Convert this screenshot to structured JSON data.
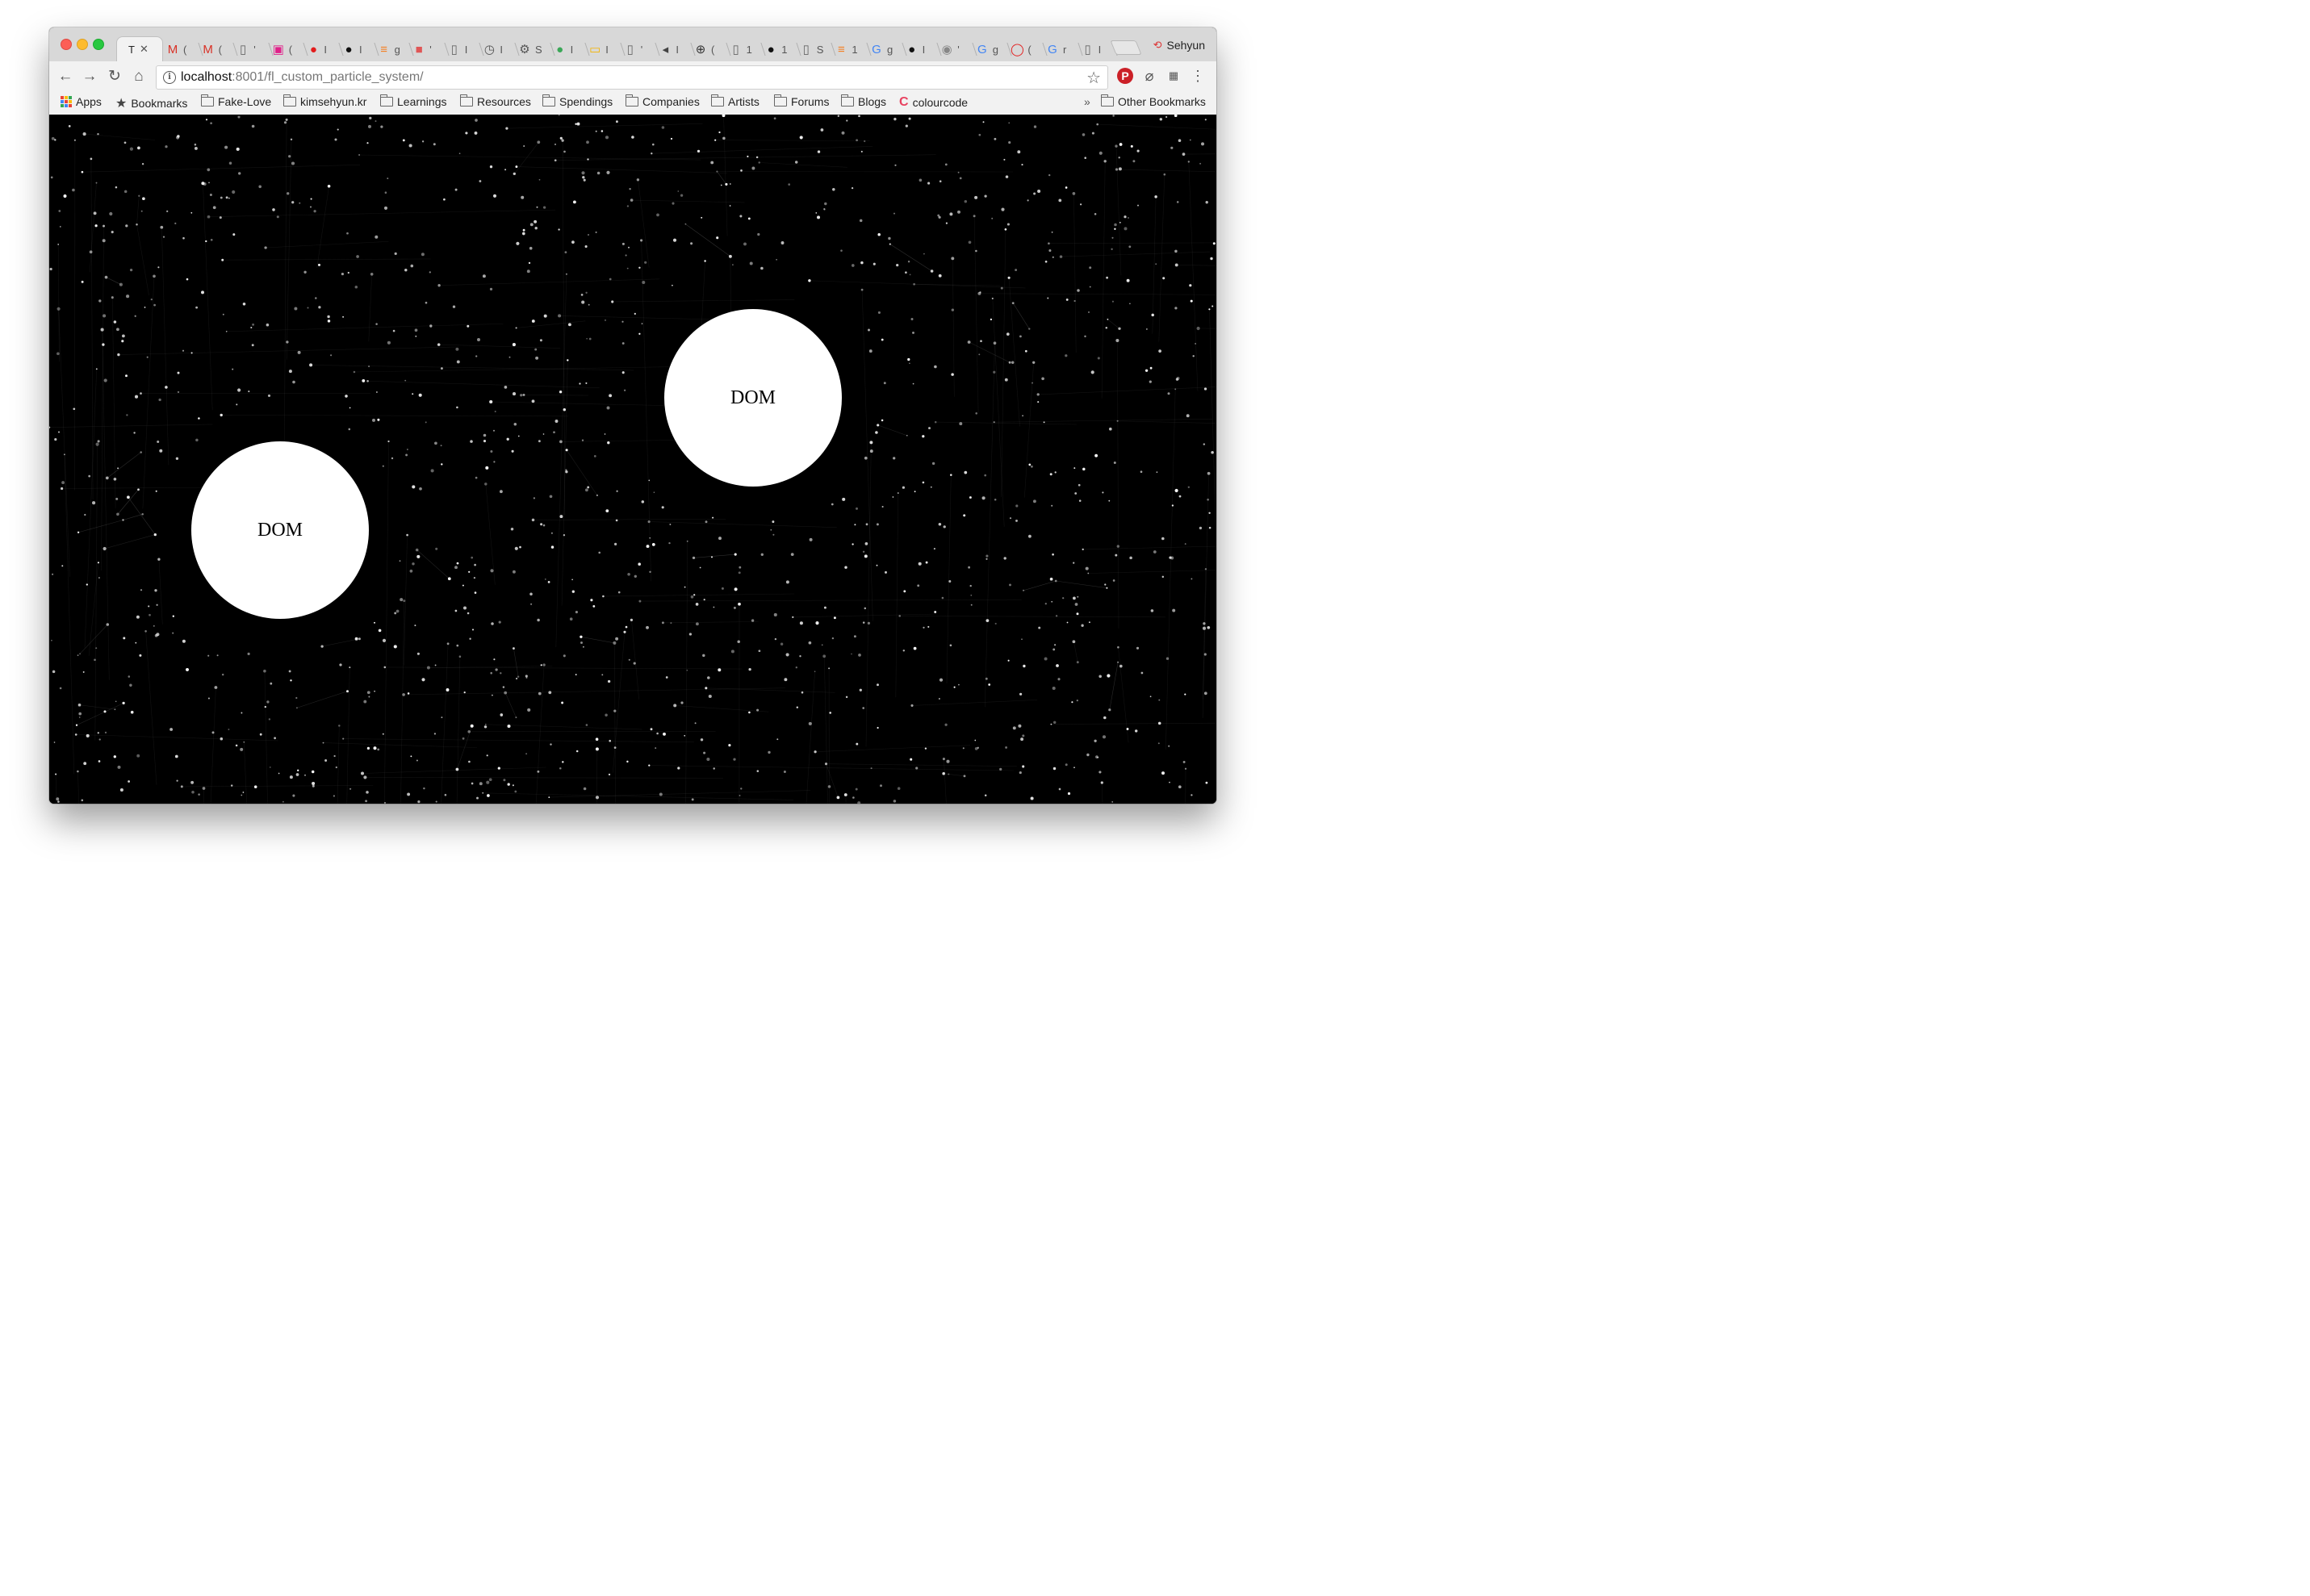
{
  "browser": {
    "active_tab_title": "T",
    "tabs": [
      {
        "icon": "gmail-icon",
        "glyph": "M",
        "label": "(",
        "color": "#d93025"
      },
      {
        "icon": "gmail-icon",
        "glyph": "M",
        "label": "(",
        "color": "#d93025"
      },
      {
        "icon": "document-icon",
        "glyph": "▯",
        "label": "'",
        "color": "#666"
      },
      {
        "icon": "chip-icon",
        "glyph": "▣",
        "label": "(",
        "color": "#e0218a"
      },
      {
        "icon": "leica-icon",
        "glyph": "●",
        "label": "I",
        "color": "#e31c1c"
      },
      {
        "icon": "github-icon",
        "glyph": "●",
        "label": "I",
        "color": "#111"
      },
      {
        "icon": "stackoverflow-icon",
        "glyph": "≡",
        "label": "g",
        "color": "#f48024"
      },
      {
        "icon": "creature-icon",
        "glyph": "■",
        "label": "'",
        "color": "#e05656"
      },
      {
        "icon": "document-icon",
        "glyph": "▯",
        "label": "I",
        "color": "#666"
      },
      {
        "icon": "history-icon",
        "glyph": "◷",
        "label": "I",
        "color": "#555"
      },
      {
        "icon": "gear-icon",
        "glyph": "⚙",
        "label": "S",
        "color": "#555"
      },
      {
        "icon": "android-icon",
        "glyph": "●",
        "label": "I",
        "color": "#3aa757"
      },
      {
        "icon": "slides-icon",
        "glyph": "▭",
        "label": "I",
        "color": "#f4b400"
      },
      {
        "icon": "document-icon",
        "glyph": "▯",
        "label": "'",
        "color": "#666"
      },
      {
        "icon": "speaker-icon",
        "glyph": "◂",
        "label": "I",
        "color": "#444"
      },
      {
        "icon": "crosshair-icon",
        "glyph": "⊕",
        "label": "(",
        "color": "#333"
      },
      {
        "icon": "document-icon",
        "glyph": "▯",
        "label": "1",
        "color": "#666"
      },
      {
        "icon": "github-icon",
        "glyph": "●",
        "label": "1",
        "color": "#111"
      },
      {
        "icon": "document-icon",
        "glyph": "▯",
        "label": "S",
        "color": "#666"
      },
      {
        "icon": "stackoverflow-icon",
        "glyph": "≡",
        "label": "1",
        "color": "#f48024"
      },
      {
        "icon": "google-icon",
        "glyph": "G",
        "label": "g",
        "color": "#4285f4"
      },
      {
        "icon": "github-icon",
        "glyph": "●",
        "label": "I",
        "color": "#111"
      },
      {
        "icon": "bot-icon",
        "glyph": "◉",
        "label": "'",
        "color": "#888"
      },
      {
        "icon": "google-icon",
        "glyph": "G",
        "label": "g",
        "color": "#4285f4"
      },
      {
        "icon": "ring-icon",
        "glyph": "◯",
        "label": "(",
        "color": "#e31c1c"
      },
      {
        "icon": "google-icon",
        "glyph": "G",
        "label": "r",
        "color": "#4285f4"
      },
      {
        "icon": "document-icon",
        "glyph": "▯",
        "label": "I",
        "color": "#666"
      }
    ],
    "profile_name": "Sehyun",
    "url_host": "localhost",
    "url_rest": ":8001/fl_custom_particle_system/",
    "bookmarks": {
      "apps": "Apps",
      "bookmarks": "Bookmarks",
      "folders": [
        "Fake-Love",
        "kimsehyun.kr",
        "Learnings",
        "Resources",
        "Spendings",
        "Companies",
        "Artists",
        "Forums",
        "Blogs"
      ],
      "colourcode": "colourcode",
      "overflow": "»",
      "other": "Other Bookmarks"
    }
  },
  "page": {
    "background": "#000000",
    "circles": [
      {
        "label": "DOM"
      },
      {
        "label": "DOM"
      }
    ]
  }
}
